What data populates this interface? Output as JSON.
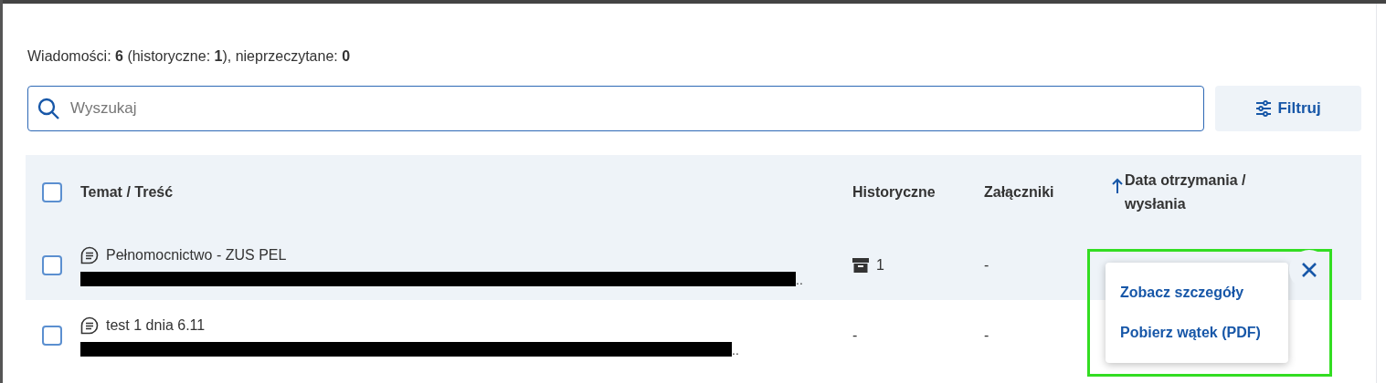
{
  "summary": "Wiadomości: **6** (historyczne: **1**), nieprzeczytane: **0**",
  "search": {
    "placeholder": "Wyszukaj"
  },
  "filter_button": {
    "label": "Filtruj"
  },
  "table": {
    "all_checked": false,
    "columns": [
      {
        "label": "Temat / Treść",
        "sorted": false
      },
      {
        "label": "Historyczne",
        "sorted": false
      },
      {
        "label": "Załączniki",
        "sorted": false
      },
      {
        "label": "Data otrzymania / wysłania",
        "sorted": true
      }
    ],
    "rows": [
      {
        "checked": false,
        "highlighted": true,
        "subject": "Pełnomocnictwo - ZUS PEL",
        "preview_tail": "..",
        "historical": "1",
        "archived": true,
        "attachments": "-"
      },
      {
        "checked": false,
        "highlighted": false,
        "subject": "test 1 dnia 6.11",
        "preview_tail": "..",
        "historical": "-",
        "archived": false,
        "attachments": "-"
      }
    ]
  },
  "row_menu": {
    "items": [
      "Zobacz szczegóły",
      "Pobierz wątek (PDF)"
    ]
  }
}
